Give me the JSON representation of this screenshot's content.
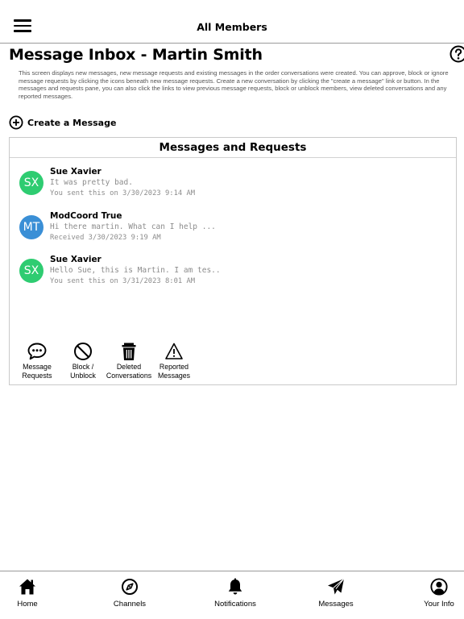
{
  "header": {
    "title": "All Members"
  },
  "page": {
    "title": "Message Inbox - Martin Smith",
    "description": "This screen displays new messages, new message requests and existing messages in the order conversations were created. You can approve, block or ignore message requests by clicking the icons beneath new message requests. Create a new conversation by clicking the \"create a message\" link or button. In the messages and requests pane, you can also click the links to view previous message requests, block or unblock members, view deleted conversations and any reported messages.",
    "create_label": "Create a Message"
  },
  "panel": {
    "title": "Messages and Requests",
    "messages": [
      {
        "initials": "SX",
        "name": "Sue Xavier",
        "preview": "It was pretty bad.",
        "time": "You sent this on 3/30/2023 9:14 AM",
        "color": "#2ecc71"
      },
      {
        "initials": "MT",
        "name": "ModCoord True",
        "preview": "Hi there martin. What can I help ...",
        "time": "Received 3/30/2023 9:19 AM",
        "color": "#3a8fd6"
      },
      {
        "initials": "SX",
        "name": "Sue Xavier",
        "preview": "Hello Sue, this is Martin. I am tes..",
        "time": "You sent this on 3/31/2023 8:01 AM",
        "color": "#2ecc71"
      }
    ],
    "actions": [
      {
        "line1": "Message",
        "line2": "Requests",
        "icon": "chat-bubble-icon"
      },
      {
        "line1": "Block /",
        "line2": "Unblock",
        "icon": "block-icon"
      },
      {
        "line1": "Deleted",
        "line2": "Conversations",
        "icon": "trash-icon"
      },
      {
        "line1": "Reported",
        "line2": "Messages",
        "icon": "warning-icon"
      }
    ]
  },
  "bottom_nav": [
    {
      "label": "Home",
      "icon": "home-icon"
    },
    {
      "label": "Channels",
      "icon": "compass-icon"
    },
    {
      "label": "Notifications",
      "icon": "bell-icon"
    },
    {
      "label": "Messages",
      "icon": "paper-plane-icon"
    },
    {
      "label": "Your Info",
      "icon": "user-circle-icon"
    }
  ]
}
